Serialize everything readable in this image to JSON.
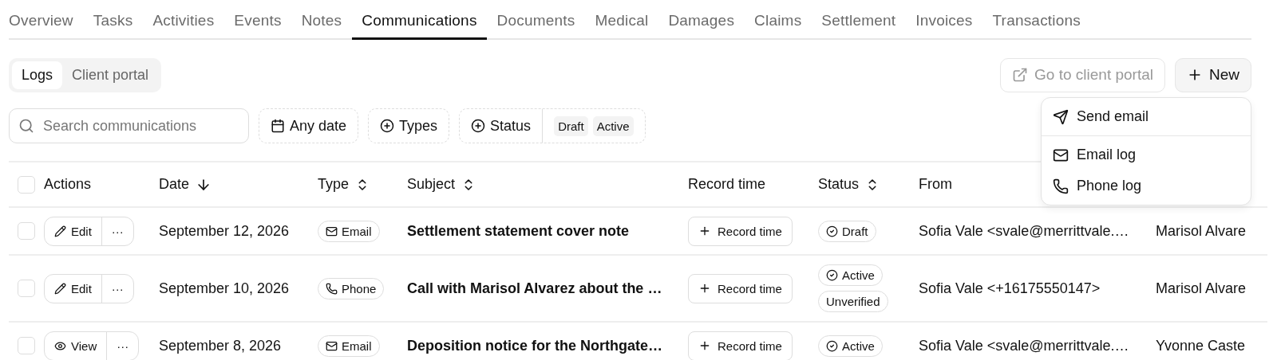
{
  "tabs": [
    {
      "label": "Overview",
      "selected": false
    },
    {
      "label": "Tasks",
      "selected": false
    },
    {
      "label": "Activities",
      "selected": false
    },
    {
      "label": "Events",
      "selected": false
    },
    {
      "label": "Notes",
      "selected": false
    },
    {
      "label": "Communications",
      "selected": true
    },
    {
      "label": "Documents",
      "selected": false
    },
    {
      "label": "Medical",
      "selected": false
    },
    {
      "label": "Damages",
      "selected": false
    },
    {
      "label": "Claims",
      "selected": false
    },
    {
      "label": "Settlement",
      "selected": false
    },
    {
      "label": "Invoices",
      "selected": false
    },
    {
      "label": "Transactions",
      "selected": false
    }
  ],
  "view_switch": [
    {
      "label": "Logs",
      "selected": true
    },
    {
      "label": "Client portal",
      "selected": false
    }
  ],
  "portal_button": {
    "label": "Go to client portal",
    "disabled": true
  },
  "new_button": {
    "label": "New"
  },
  "new_menu": [
    {
      "label": "Send email",
      "kind": "send"
    },
    {
      "label": "Email log",
      "kind": "email"
    },
    {
      "label": "Phone log",
      "kind": "phone"
    }
  ],
  "search": {
    "placeholder": "Search communications"
  },
  "filters": {
    "date": "Any date",
    "types": "Types",
    "status": "Status",
    "status_values": [
      "Draft",
      "Active"
    ]
  },
  "table": {
    "select_all_checked": false,
    "columns": [
      {
        "label": "Actions",
        "sortable": false,
        "sorted": false
      },
      {
        "label": "Date",
        "sortable": true,
        "sorted": true
      },
      {
        "label": "Type",
        "sortable": true,
        "sorted": false
      },
      {
        "label": "Subject",
        "sortable": true,
        "sorted": false
      },
      {
        "label": "Record time",
        "sortable": false,
        "sorted": false
      },
      {
        "label": "Status",
        "sortable": true,
        "sorted": false
      },
      {
        "label": "From",
        "sortable": false,
        "sorted": false
      }
    ],
    "rows": [
      {
        "checked": false,
        "action": {
          "kind": "edit",
          "label": "Edit"
        },
        "more": "···",
        "date": "September 12, 2026",
        "type": {
          "kind": "email",
          "label": "Email"
        },
        "subject": "Settlement statement cover note",
        "record": "Record time",
        "statuses": [
          {
            "kind": "state",
            "label": "Draft"
          }
        ],
        "from": "Sofia Vale <svale@merrittvale.…",
        "to": "Marisol Alvare"
      },
      {
        "checked": false,
        "action": {
          "kind": "edit",
          "label": "Edit"
        },
        "more": "···",
        "date": "September 10, 2026",
        "type": {
          "kind": "phone",
          "label": "Phone"
        },
        "subject": "Call with Marisol Alvarez about the …",
        "record": "Record time",
        "statuses": [
          {
            "kind": "state",
            "label": "Active"
          },
          {
            "kind": "flag",
            "label": "Unverified"
          }
        ],
        "from": "Sofia Vale <+16175550147>",
        "to": "Marisol Alvare"
      },
      {
        "checked": false,
        "action": {
          "kind": "view",
          "label": "View"
        },
        "more": "···",
        "date": "September 8, 2026",
        "type": {
          "kind": "email",
          "label": "Email"
        },
        "subject": "Deposition notice for the Northgate…",
        "record": "Record time",
        "statuses": [
          {
            "kind": "state",
            "label": "Active"
          }
        ],
        "from": "Sofia Vale <svale@merrittvale.…",
        "to": "Yvonne Caste"
      }
    ]
  }
}
